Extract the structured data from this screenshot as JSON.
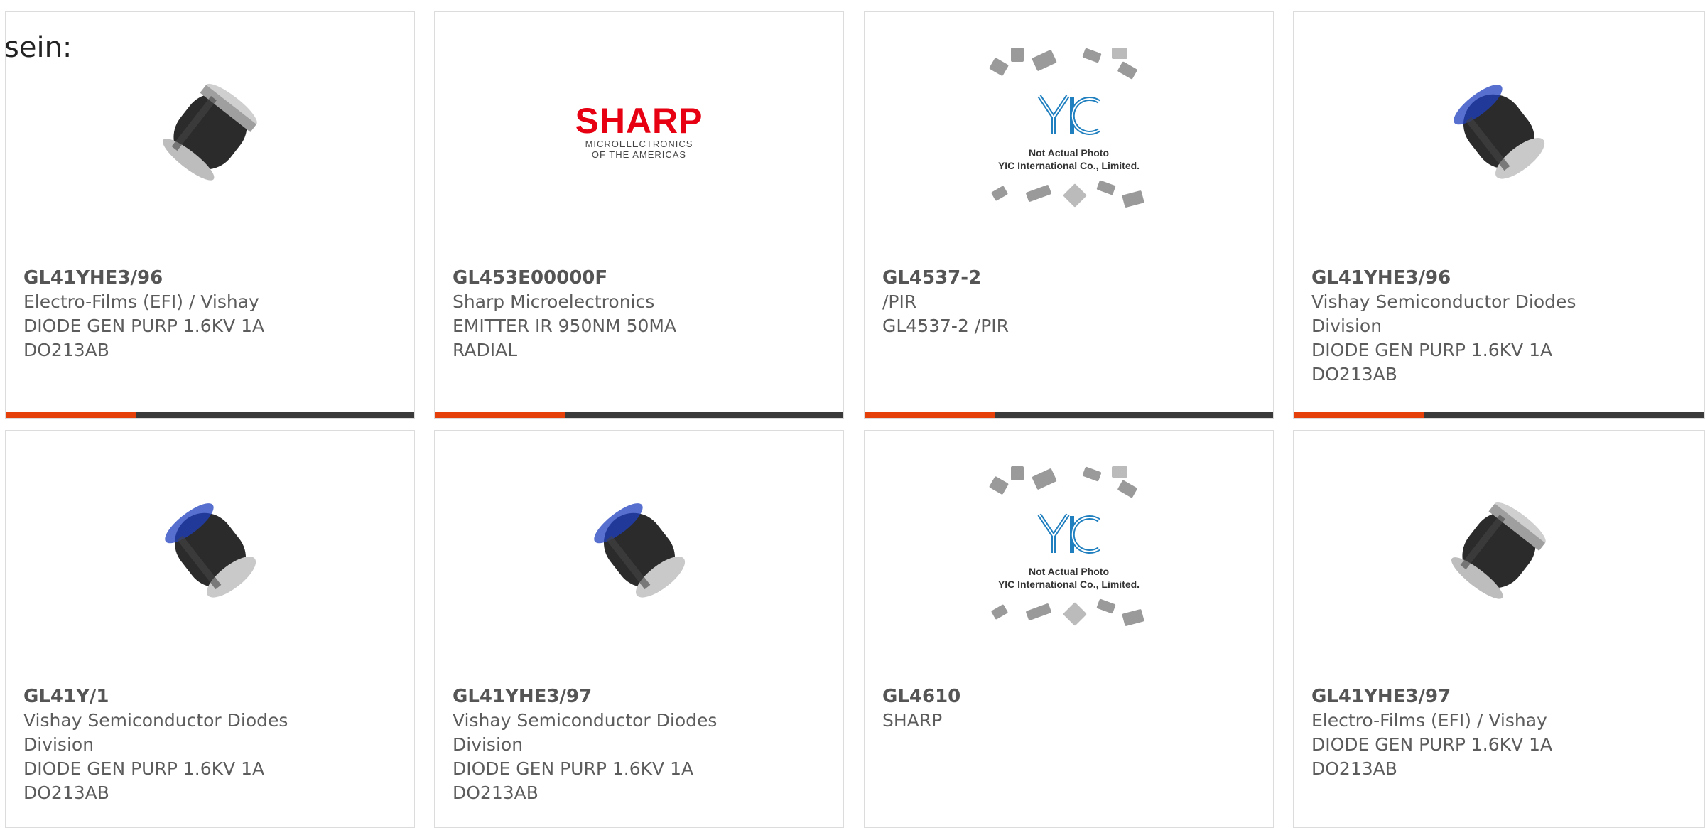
{
  "lead_text": "sein:",
  "accent_color": "#e5400a",
  "bar_color": "#3a3a3a",
  "cards": [
    {
      "part": "GL41YHE3/96",
      "lines": [
        "Electro-Films (EFI) / Vishay",
        "DIODE GEN PURP 1.6KV 1A",
        "DO213AB"
      ],
      "image": "diode-melf-icon"
    },
    {
      "part": "GL453E00000F",
      "lines": [
        "Sharp Microelectronics",
        "EMITTER IR 950NM 50MA",
        "RADIAL"
      ],
      "image": "sharp-logo"
    },
    {
      "part": "GL4537-2",
      "lines": [
        "/PIR",
        "GL4537-2 /PIR"
      ],
      "image": "yic-placeholder"
    },
    {
      "part": "GL41YHE3/96",
      "lines": [
        "Vishay Semiconductor Diodes",
        "Division",
        "DIODE GEN PURP 1.6KV 1A",
        "DO213AB"
      ],
      "image": "diode-melf-icon"
    },
    {
      "part": "GL41Y/1",
      "lines": [
        "Vishay Semiconductor Diodes",
        "Division",
        "DIODE GEN PURP 1.6KV 1A",
        "DO213AB"
      ],
      "image": "diode-melf-icon"
    },
    {
      "part": "GL41YHE3/97",
      "lines": [
        "Vishay Semiconductor Diodes",
        "Division",
        "DIODE GEN PURP 1.6KV 1A",
        "DO213AB"
      ],
      "image": "diode-melf-icon"
    },
    {
      "part": "GL4610",
      "lines": [
        "SHARP"
      ],
      "image": "yic-placeholder"
    },
    {
      "part": "GL41YHE3/97",
      "lines": [
        "Electro-Films (EFI) / Vishay",
        "DIODE GEN PURP 1.6KV 1A",
        "DO213AB"
      ],
      "image": "diode-melf-icon"
    }
  ],
  "sharp": {
    "word": "SHARP",
    "sub1": "MICROELECTRONICS",
    "sub2": "OF THE AMERICAS"
  },
  "yic": {
    "line1": "Not Actual Photo",
    "line2": "YIC International Co., Limited."
  }
}
